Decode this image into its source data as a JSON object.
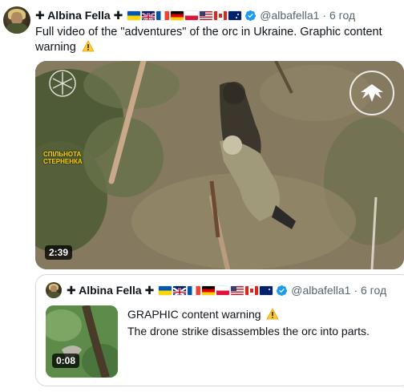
{
  "tweet": {
    "author": {
      "name": "✚ Albina Fella ✚",
      "handle": "@albafella1",
      "time": "· 6 год"
    },
    "flags": [
      "ukraine",
      "united-kingdom",
      "france",
      "germany",
      "poland",
      "usa",
      "canada",
      "australia"
    ],
    "text": "Full video of the \"adventures\" of the orc in Ukraine. Graphic content warning",
    "warning_icon": "warning-icon",
    "media": {
      "duration": "2:39",
      "watermark_text": "СПІЛЬНОТА\nСТЕРНЕНКА"
    }
  },
  "quoted_tweet": {
    "author": {
      "name": "✚ Albina Fella ✚",
      "handle": "@albafella1",
      "time": "· 6 год"
    },
    "line1": "GRAPHIC content warning",
    "line2": "The drone strike disassembles the orc into parts.",
    "media": {
      "duration": "0:08"
    }
  },
  "colors": {
    "text": "#0f1419",
    "secondary": "#536471",
    "verified": "#1d9bf0",
    "border": "#cfd9de"
  }
}
